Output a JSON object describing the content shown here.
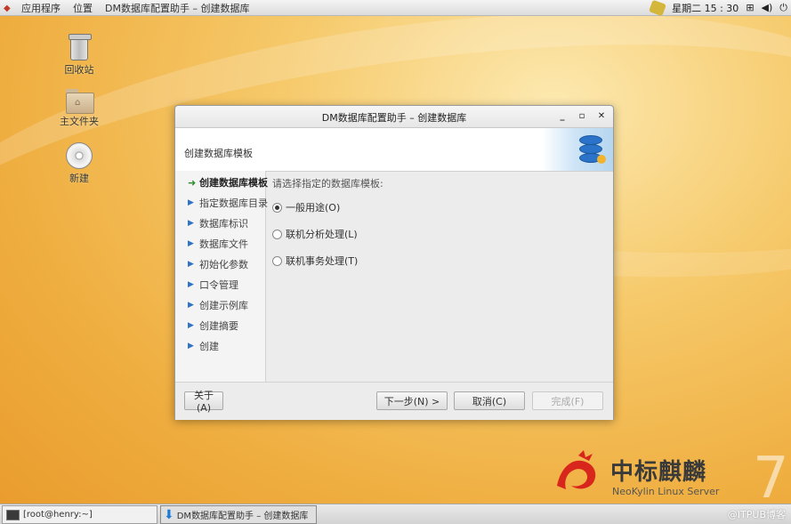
{
  "top_panel": {
    "applications": "应用程序",
    "places": "位置",
    "active_window": "DM数据库配置助手 – 创建数据库",
    "clock": "星期二 15 : 30"
  },
  "desktop": {
    "icons": [
      {
        "label": "回收站"
      },
      {
        "label": "主文件夹"
      },
      {
        "label": "新建"
      }
    ]
  },
  "dialog": {
    "title": "DM数据库配置助手 – 创建数据库",
    "heading": "创建数据库模板",
    "steps": [
      {
        "label": "创建数据库模板",
        "active": true
      },
      {
        "label": "指定数据库目录"
      },
      {
        "label": "数据库标识"
      },
      {
        "label": "数据库文件"
      },
      {
        "label": "初始化参数"
      },
      {
        "label": "口令管理"
      },
      {
        "label": "创建示例库"
      },
      {
        "label": "创建摘要"
      },
      {
        "label": "创建"
      }
    ],
    "prompt": "请选择指定的数据库模板:",
    "options": [
      {
        "label": "一般用途(O)",
        "selected": true
      },
      {
        "label": "联机分析处理(L)",
        "selected": false
      },
      {
        "label": "联机事务处理(T)",
        "selected": false
      }
    ],
    "buttons": {
      "about": "关于(A)",
      "next": "下一步(N) >",
      "cancel": "取消(C)",
      "finish": "完成(F)"
    }
  },
  "brand": {
    "name_cn": "中标麒麟",
    "name_en": "NeoKylin Linux Server",
    "version_mark": "7"
  },
  "taskbar": {
    "tasks": [
      {
        "label": "[root@henry:~]"
      },
      {
        "label": "DM数据库配置助手 – 创建数据库"
      }
    ],
    "watermark": "@ITPUB博客"
  },
  "colors": {
    "desktop_accent": "#efae40",
    "step_marker": "#2f73c4",
    "active_step_marker": "#2e8b2e",
    "brand_red": "#d8261c"
  }
}
